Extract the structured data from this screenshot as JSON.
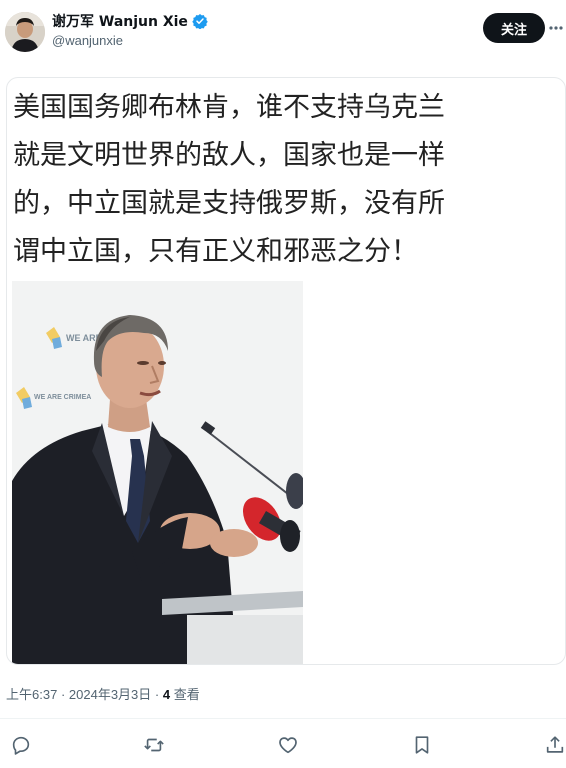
{
  "author": {
    "display_name": "谢万军 Wanjun Xie",
    "handle": "@wanjunxie",
    "verified": true,
    "avatar_icon": "user-avatar"
  },
  "header": {
    "follow_label": "关注",
    "more_icon": "more-horizontal-icon"
  },
  "post": {
    "text_lines": [
      "美国国务卿布林肯，谁不支持乌克兰",
      "就是文明世界的敌人，国家也是一样",
      "的，中立国就是支持俄罗斯，没有所",
      "谓中立国，只有正义和邪恶之分！"
    ],
    "photo_sign_text": "WE ARE",
    "photo_sign_text_2": "WE ARE CRIMEA"
  },
  "meta": {
    "time": "上午6:37",
    "separator": "·",
    "date": "2024年3月3日",
    "views_count": "4",
    "views_label": "查看"
  },
  "actions": [
    {
      "name": "reply",
      "icon": "reply-icon"
    },
    {
      "name": "repost",
      "icon": "repost-icon"
    },
    {
      "name": "like",
      "icon": "heart-icon"
    },
    {
      "name": "bookmark",
      "icon": "bookmark-icon"
    },
    {
      "name": "share",
      "icon": "share-icon"
    }
  ],
  "colors": {
    "text_primary": "#0f1419",
    "text_secondary": "#536471",
    "verified_blue": "#1d9bf0",
    "button_dark": "#0f1419"
  }
}
